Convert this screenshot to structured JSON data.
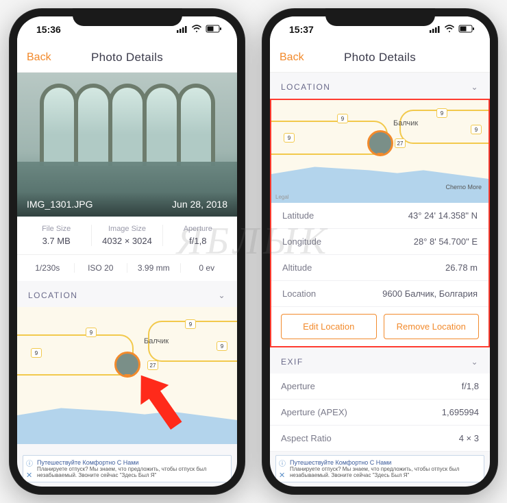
{
  "watermark": "ЯБЛЫК",
  "left": {
    "status": {
      "time": "15:36"
    },
    "nav": {
      "back": "Back",
      "title": "Photo Details"
    },
    "photo": {
      "filename": "IMG_1301.JPG",
      "date": "Jun 28, 2018"
    },
    "meta": {
      "filesize_label": "File Size",
      "filesize": "3.7 MB",
      "imagesize_label": "Image Size",
      "imagesize": "4032 × 3024",
      "aperture_label": "Aperture",
      "aperture": "f/1,8",
      "shutter": "1/230s",
      "iso": "ISO 20",
      "focal": "3.99 mm",
      "ev": "0 ev"
    },
    "location_header": "LOCATION",
    "map": {
      "city": "Балчик",
      "roads": [
        "9",
        "9",
        "27",
        "9",
        "9"
      ]
    }
  },
  "right": {
    "status": {
      "time": "15:37"
    },
    "nav": {
      "back": "Back",
      "title": "Photo Details"
    },
    "location_header": "LOCATION",
    "map": {
      "city": "Балчик",
      "cherno": "Cherno More",
      "legal": "Legal",
      "roads": [
        "9",
        "9",
        "27",
        "9",
        "9"
      ]
    },
    "details": {
      "lat_label": "Latitude",
      "lat": "43° 24' 14.358\" N",
      "lon_label": "Longitude",
      "lon": "28° 8' 54.700\" E",
      "alt_label": "Altitude",
      "alt": "26.78 m",
      "loc_label": "Location",
      "loc": "9600 Балчик, Болгария"
    },
    "buttons": {
      "edit": "Edit Location",
      "remove": "Remove Location"
    },
    "exif_header": "EXIF",
    "exif": {
      "ap_label": "Aperture",
      "ap": "f/1,8",
      "apex_label": "Aperture (APEX)",
      "apex": "1,695994",
      "ar_label": "Aspect Ratio",
      "ar": "4 × 3"
    }
  },
  "ad": {
    "title": "Путешествуйте Комфортно С Нами",
    "body": "Планируете отпуск? Мы знаем, что предложить, чтобы отпуск был незабываемый. Звоните сейчас \"Здесь Был Я\""
  }
}
